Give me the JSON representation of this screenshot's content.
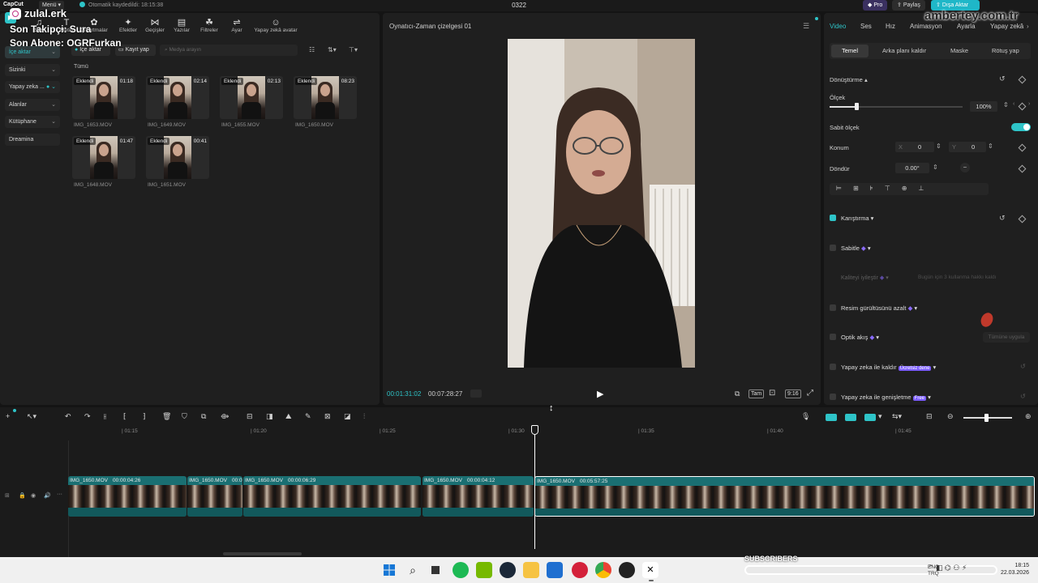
{
  "titlebar": {
    "app_name": "CapCut",
    "menu_label": "Menü",
    "autosave": "Otomatik kaydedildi: 18:15:38",
    "project": "0322",
    "pro_label": "Pro",
    "share_label": "Paylaş",
    "export_label": "Dışa Aktar"
  },
  "overlay": {
    "channel": "zulal.erk",
    "followers": "Son Takipçi: Sura",
    "subscriber": "Son Abone: OGRFurkan",
    "site": "ambertey.com.tr",
    "subscribers_banner": "SUBSCRIBERS"
  },
  "media_tabs": [
    {
      "icon": "media-icon",
      "label": "İçe aktar"
    },
    {
      "icon": "audio-icon",
      "label": "Ses"
    },
    {
      "icon": "text-icon",
      "label": "Metin"
    },
    {
      "icon": "sticker-icon",
      "label": "Çıkartmalar"
    },
    {
      "icon": "effects-icon",
      "label": "Efektler"
    },
    {
      "icon": "transitions-icon",
      "label": "Geçişler"
    },
    {
      "icon": "captions-icon",
      "label": "Yazılar"
    },
    {
      "icon": "filters-icon",
      "label": "Filtreler"
    },
    {
      "icon": "adjust-icon",
      "label": "Ayar"
    },
    {
      "icon": "ai-avatar-icon",
      "label": "Yapay zekâ avatar"
    }
  ],
  "sidebar": {
    "items": [
      {
        "label": "İçe aktar",
        "active": true
      },
      {
        "label": "Sizinki"
      },
      {
        "label": "Yapay zeka ..."
      },
      {
        "label": "Alanlar"
      },
      {
        "label": "Kütüphane"
      },
      {
        "label": "Dreamina"
      }
    ]
  },
  "media": {
    "import_button": "İçe aktar",
    "record_button": "Kayıt yap",
    "search_placeholder": "Medya arayın",
    "filter_all": "Tümü",
    "badge": "Eklendi",
    "items": [
      {
        "name": "IMG_1653.MOV",
        "duration": "01:18"
      },
      {
        "name": "IMG_1649.MOV",
        "duration": "02:14"
      },
      {
        "name": "IMG_1655.MOV",
        "duration": "02:13"
      },
      {
        "name": "IMG_1650.MOV",
        "duration": "08:23"
      },
      {
        "name": "IMG_1648.MOV",
        "duration": "01:47"
      },
      {
        "name": "IMG_1651.MOV",
        "duration": "00:41"
      }
    ]
  },
  "player": {
    "title": "Oynatıcı-Zaman çizelgesi 01",
    "current_time": "00:01:31:02",
    "total_time": "00:07:28:27",
    "quality": "Tam",
    "ratio": "9:16"
  },
  "properties": {
    "tabs": [
      "Video",
      "Ses",
      "Hız",
      "Animasyon",
      "Ayarla",
      "Yapay zekâ"
    ],
    "subtabs": [
      "Temel",
      "Arka planı kaldır",
      "Maske",
      "Rötuş yap"
    ],
    "transform_label": "Dönüştürme",
    "scale_label": "Ölçek",
    "scale_value": "100%",
    "scale_fraction": 0.2,
    "uniform_scale_label": "Sabit ölçek",
    "position_label": "Konum",
    "x_label": "X",
    "x_value": "0",
    "y_label": "Y",
    "y_value": "0",
    "rotate_label": "Döndür",
    "rotate_value": "0.00°",
    "blend_label": "Karıştırma",
    "stabilize_label": "Sabitle",
    "enhance_label": "Kaliteyi iyileştir",
    "enhance_hint": "Bugün için 3 kullanma hakkı kaldı",
    "denoise_label": "Resim gürültüsünü azalt",
    "flicker_label": "Optik akış",
    "apply_all": "Tümüne uygula",
    "ai_remove_label": "Yapay zeka ile kaldır",
    "ai_remove_badge": "Ücretsiz dene",
    "ai_expand_label": "Yapay zeka ile genişletme",
    "ai_expand_badge": "Free"
  },
  "timeline": {
    "ruler": [
      "01:15",
      "01:20",
      "01:25",
      "01:30",
      "01:35",
      "01:40",
      "01:45"
    ],
    "clips": [
      {
        "name": "IMG_1650.MOV",
        "duration": "00:00:04:26"
      },
      {
        "name": "IMG_1650.MOV",
        "duration": "00:0"
      },
      {
        "name": "IMG_1650.MOV",
        "duration": "00:00:06:29"
      },
      {
        "name": "IMG_1650.MOV",
        "duration": "00:00:04:12"
      },
      {
        "name": "IMG_1650.MOV",
        "duration": "00:05:57:25"
      }
    ]
  },
  "taskbar": {
    "lang": "ENG",
    "lang2": "TRQ",
    "time": "18:15",
    "date": "22.03.2026"
  },
  "colors": {
    "accent": "#2ec4c8",
    "export": "#1fb7c8",
    "clip": "#1a6f72",
    "pro": "#7b5cff"
  }
}
